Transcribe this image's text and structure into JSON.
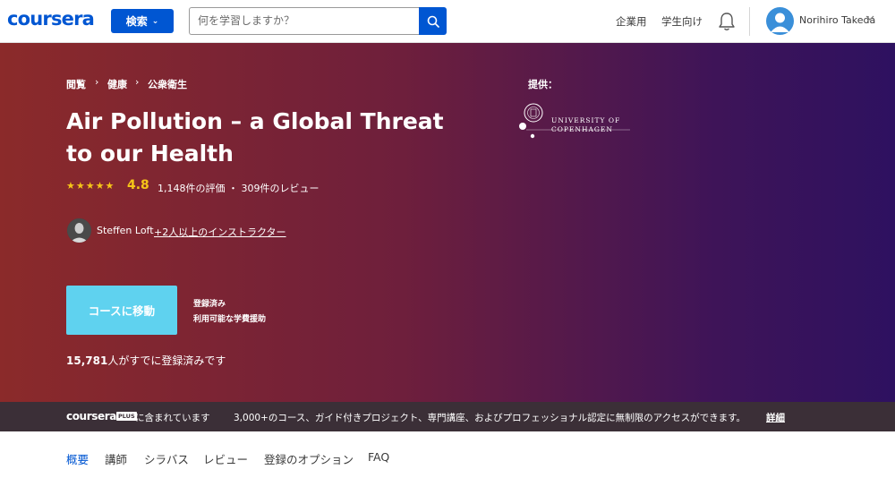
{
  "header": {
    "logo": "coursera",
    "search_button": "検索",
    "search_placeholder": "何を学習しますか？",
    "nav": [
      "企業用",
      "学生向け"
    ],
    "username": "Norihiro Takeda"
  },
  "hero": {
    "breadcrumb": [
      "閲覧",
      "健康",
      "公衆衛生"
    ],
    "breadcrumb_separator": "›",
    "title": "Air Pollution – a Global Threat to our Health",
    "stars": "★★★★★",
    "rating": "4.8",
    "rating_meta": "1,148件の評価 ・ 309件のレビュー",
    "instructor": "Steffen Loft",
    "instructor_more": "+2人以上のインストラクター",
    "cta_label": "コースに移動",
    "enrolled_label": "登録済み",
    "aid_label": "利用可能な学費援助",
    "enrolled_count": "15,781",
    "enrolled_count_suffix": "人がすでに登録済みです",
    "offered_by": "提供：",
    "university_line1": "UNIVERSITY OF",
    "university_line2": "COPENHAGEN"
  },
  "plus_band": {
    "logo": "coursera",
    "badge": "PLUS",
    "included": "に含まれています",
    "description": "3,000+のコース、ガイド付きプロジェクト、専門講座、およびプロフェッショナル認定に無制限のアクセスができます。",
    "more": "詳細"
  },
  "tabs": [
    "概要",
    "講師",
    "シラバス",
    "レビュー",
    "登録のオプション",
    "FAQ"
  ],
  "colors": {
    "brand": "#0056d2",
    "cta": "#5fd2ef",
    "star": "#f5c518",
    "hero_start": "#8b2a2a",
    "hero_end": "#2e1160"
  }
}
